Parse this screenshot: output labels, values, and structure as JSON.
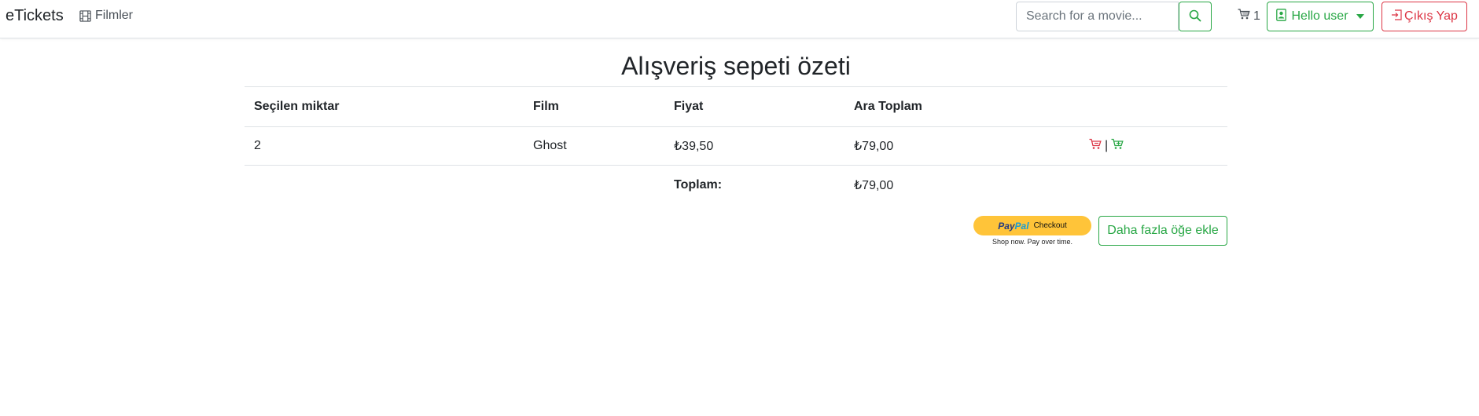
{
  "navbar": {
    "brand": "eTickets",
    "movies_link": "Filmler",
    "search_placeholder": "Search for a movie...",
    "cart_count": "1",
    "user_label": "Hello user",
    "logout_label": "Çıkış Yap"
  },
  "page": {
    "title": "Alışveriş sepeti özeti"
  },
  "table": {
    "headers": [
      "Seçilen miktar",
      "Film",
      "Fiyat",
      "Ara Toplam"
    ],
    "rows": [
      {
        "quantity": "2",
        "film": "Ghost",
        "price": "₺39,50",
        "subtotal": "₺79,00"
      }
    ],
    "total_label": "Toplam:",
    "total_value": "₺79,00",
    "action_separator": "|"
  },
  "checkout": {
    "paypal_pay": "Pay",
    "paypal_pal": "Pal",
    "paypal_checkout": "Checkout",
    "paypal_tagline": "Shop now. Pay over time.",
    "add_more_label": "Daha fazla öğe ekle"
  },
  "colors": {
    "success": "#28a745",
    "danger": "#dc3545",
    "paypal_yellow": "#ffc439"
  }
}
